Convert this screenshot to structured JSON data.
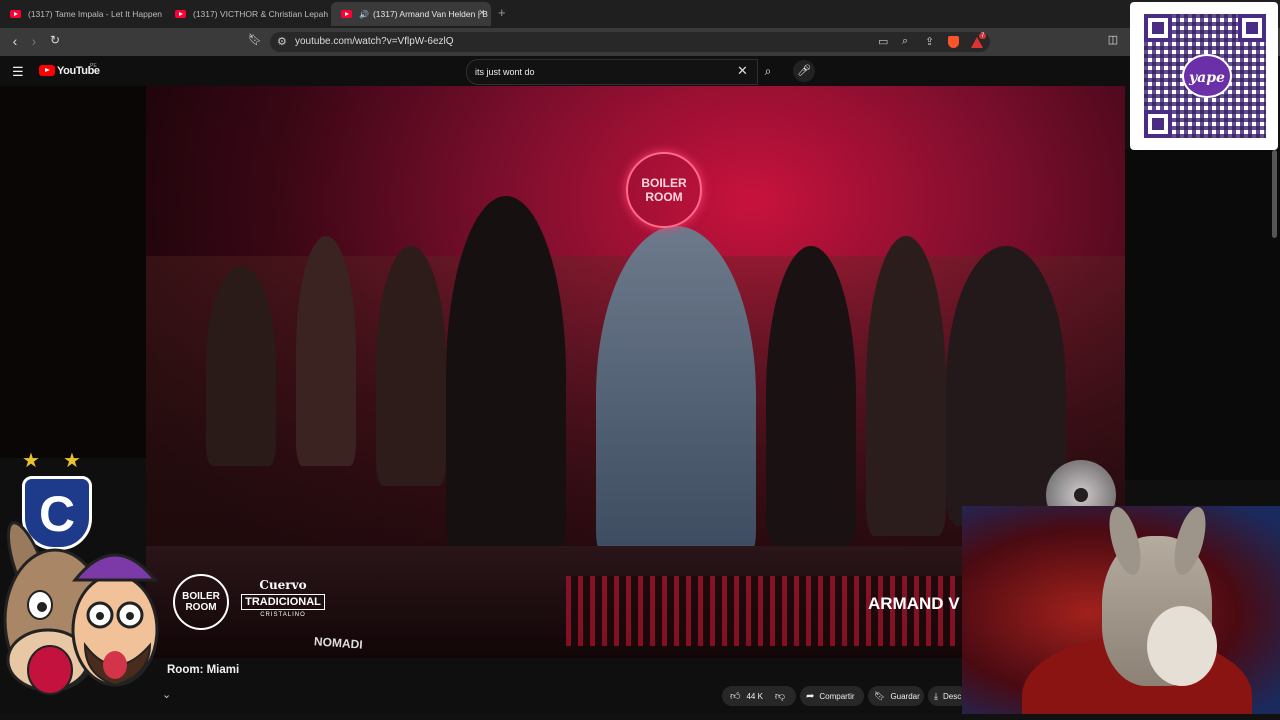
{
  "browser": {
    "tabs": [
      {
        "title": "(1317) Tame Impala - Let It Happen (",
        "active": false
      },
      {
        "title": "(1317) VICTHOR & Christian Lepah -",
        "active": false
      },
      {
        "title": "(1317) Armand Van Helden | B",
        "active": true
      }
    ],
    "new_tab": "+",
    "close_tab": "×",
    "url": "youtube.com/watch?v=VflpW-6ezlQ",
    "brave_badge": "7"
  },
  "youtube": {
    "logo_text": "YouTube",
    "logo_country": "PE",
    "search_value": "its just wont do",
    "video_title": "Room: Miami",
    "like_count": "44 K",
    "share_label": "Compartir",
    "save_label": "Guardar",
    "download_label": "Desc"
  },
  "video_overlay": {
    "neon_sign": "BOILER ROOM",
    "corner_logo": "BOILER ROOM",
    "sponsor_line1": "Cuervo",
    "sponsor_line2": "TRADICIONAL",
    "sponsor_line3": "CRISTALINO",
    "artist_banner": "ARMAND V",
    "table_text": "NOMADI"
  },
  "stream_overlay": {
    "qr_brand": "yape",
    "badge_letter": "C",
    "stars": [
      "★",
      "★"
    ]
  },
  "colors": {
    "accent": "#ff0033",
    "stage_red": "#c8123d",
    "yape_purple": "#6b2fa8"
  }
}
